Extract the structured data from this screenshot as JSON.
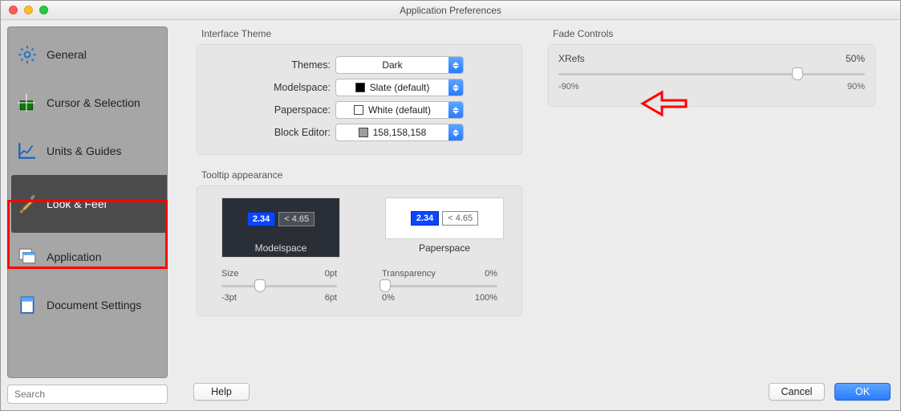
{
  "window": {
    "title": "Application Preferences"
  },
  "sidebar": {
    "items": [
      {
        "label": "General"
      },
      {
        "label": "Cursor & Selection"
      },
      {
        "label": "Units & Guides"
      },
      {
        "label": "Look & Feel"
      },
      {
        "label": "Application"
      },
      {
        "label": "Document Settings"
      }
    ],
    "active_index": 3
  },
  "search": {
    "placeholder": "Search"
  },
  "sections": {
    "interface_theme": {
      "title": "Interface Theme",
      "rows": {
        "themes_label": "Themes:",
        "themes_value": "Dark",
        "modelspace_label": "Modelspace:",
        "modelspace_value": "Slate (default)",
        "modelspace_swatch": "#000000",
        "paperspace_label": "Paperspace:",
        "paperspace_value": "White (default)",
        "paperspace_swatch": "#ffffff",
        "blockeditor_label": "Block Editor:",
        "blockeditor_value": "158,158,158",
        "blockeditor_swatch": "#9e9e9e"
      }
    },
    "fade": {
      "title": "Fade Controls",
      "xrefs_label": "XRefs",
      "value_label": "50%",
      "min_label": "-90%",
      "max_label": "90%",
      "thumb_pct": 78
    },
    "tooltip": {
      "title": "Tooltip appearance",
      "modelspace_caption": "Modelspace",
      "paperspace_caption": "Paperspace",
      "sample_value": "2.34",
      "sample_ref": "< 4.65",
      "size": {
        "label": "Size",
        "value_label": "0pt",
        "min_label": "-3pt",
        "max_label": "6pt",
        "thumb_pct": 33
      },
      "transparency": {
        "label": "Transparency",
        "value_label": "0%",
        "min_label": "0%",
        "max_label": "100%",
        "thumb_pct": 3
      }
    }
  },
  "buttons": {
    "help": "Help",
    "cancel": "Cancel",
    "ok": "OK"
  }
}
